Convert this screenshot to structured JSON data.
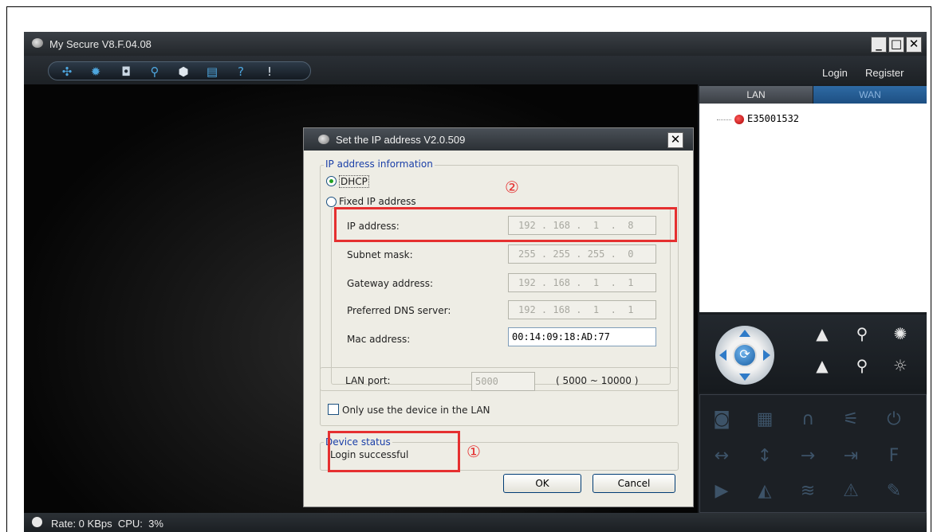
{
  "window": {
    "title": "My Secure  V8.F.04.08",
    "minimize": "_",
    "maximize": "□",
    "close": "✕"
  },
  "toolbar": {
    "icons": [
      "grid-icon",
      "gear-icon",
      "camera-icon",
      "search-icon",
      "lock-icon",
      "save-icon",
      "help-icon",
      "info-icon"
    ],
    "login_label": "Login",
    "register_label": "Register"
  },
  "sidebar": {
    "tabs": [
      {
        "label": "LAN"
      },
      {
        "label": "WAN"
      }
    ],
    "devices": [
      {
        "name": "E35001532"
      }
    ]
  },
  "status_bar": {
    "text": "Rate: 0 KBps  CPU:  3%"
  },
  "dialog": {
    "title": "Set the IP address  V2.0.509",
    "close": "✕",
    "ip_group_label": "IP address information",
    "dhcp_label": "DHCP",
    "fixed_ip_label": "Fixed IP address",
    "fields": [
      {
        "label": "IP address:",
        "value": "192 . 168 .  1  .  8"
      },
      {
        "label": "Subnet mask:",
        "value": "255 . 255 . 255 .  0"
      },
      {
        "label": "Gateway address:",
        "value": "192 . 168 .  1  .  1"
      },
      {
        "label": "Preferred DNS server:",
        "value": "192 . 168 .  1  .  1"
      },
      {
        "label": "Mac address:",
        "value": "00:14:09:18:AD:77"
      }
    ],
    "lan_port_label": "LAN port:",
    "lan_port_value": "5000",
    "lan_port_range": "( 5000 ~ 10000 )",
    "lan_only_label": "Only use the device in the LAN",
    "device_status_label": "Device status",
    "device_status_value": "Login successful",
    "ok_label": "OK",
    "cancel_label": "Cancel"
  },
  "annotations": {
    "marker_1": "①",
    "marker_2": "②",
    "color": "#e53030"
  }
}
